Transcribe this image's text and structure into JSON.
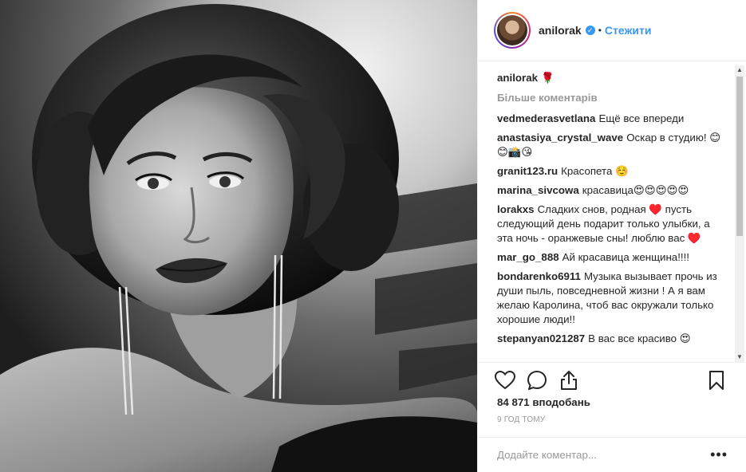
{
  "post": {
    "author": {
      "username": "anilorak",
      "verified_icon": "verified-badge-icon",
      "separator": "•",
      "follow_label": "Стежити"
    },
    "caption": {
      "username": "anilorak",
      "text": "🌹"
    },
    "more_comments_label": "Більше коментарів",
    "comments": [
      {
        "username": "vedmederasvetlana",
        "text": "Ещё все впереди"
      },
      {
        "username": "anastasiya_crystal_wave",
        "text": "Оскар в студию! 😊😊📸😘"
      },
      {
        "username": "granit123.ru",
        "text": "Красопета ☺️"
      },
      {
        "username": "marina_sivcowa",
        "text": "красавица😍😍😍😍😍"
      },
      {
        "username": "lorakxs",
        "text": "Сладких снов, родная ♥️ пусть следующий день подарит только улыбки, а эта ночь - оранжевые сны! люблю вас ♥️"
      },
      {
        "username": "mar_go_888",
        "text": "Ай красавица женщина!!!!"
      },
      {
        "username": "bondarenko6911",
        "text": "Музыка вызывает прочь из души пыль, повседневной жизни ! А я вам желаю Каролина, чтоб вас окружали только хорошие люди!!"
      },
      {
        "username": "stepanyan021287",
        "text": "В вас все красиво 😍"
      }
    ],
    "likes": "84 871 вподобань",
    "time": "9 ГОД ТОМУ",
    "add_comment_placeholder": "Додайте коментар...",
    "options_label": "•••",
    "icons": {
      "like": "heart-icon",
      "comment": "comment-icon",
      "share": "share-icon",
      "save": "bookmark-icon"
    }
  }
}
